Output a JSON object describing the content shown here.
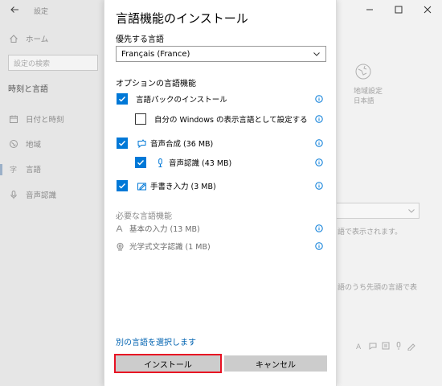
{
  "background": {
    "window_title": "設定",
    "sidebar": {
      "home": "ホーム",
      "search_placeholder": "設定の検索",
      "section": "時刻と言語",
      "items": [
        {
          "label": "日付と時刻",
          "icon": "calendar-icon"
        },
        {
          "label": "地域",
          "icon": "globe-region-icon"
        },
        {
          "label": "言語",
          "icon": "language-icon",
          "active": true
        },
        {
          "label": "音声認識",
          "icon": "microphone-icon"
        }
      ]
    },
    "region_tile": {
      "title": "地域設定",
      "value": "日本語"
    },
    "peek_text_1": "語で表示されます。",
    "peek_text_2": "語のうち先頭の言語で表"
  },
  "dialog": {
    "title": "言語機能のインストール",
    "preferred_label": "優先する言語",
    "selected_language": "Français (France)",
    "optional_label": "オプションの言語機能",
    "features": [
      {
        "label": "言語パックのインストール",
        "checked": true
      },
      {
        "label": "自分の Windows の表示言語として設定する",
        "checked": false
      },
      {
        "label": "音声合成 (36 MB)",
        "checked": true
      },
      {
        "label": "音声認識 (43 MB)",
        "checked": true
      },
      {
        "label": "手書き入力 (3 MB)",
        "checked": true
      }
    ],
    "required_label": "必要な言語機能",
    "required": [
      {
        "label": "基本の入力 (13 MB)"
      },
      {
        "label": "光学式文字認識 (1 MB)"
      }
    ],
    "other_language_link": "別の言語を選択します",
    "install_button": "インストール",
    "cancel_button": "キャンセル"
  },
  "colors": {
    "accent": "#0078d7",
    "link": "#0063b1",
    "highlight_border": "#e81123",
    "button_bg": "#cccccc"
  }
}
